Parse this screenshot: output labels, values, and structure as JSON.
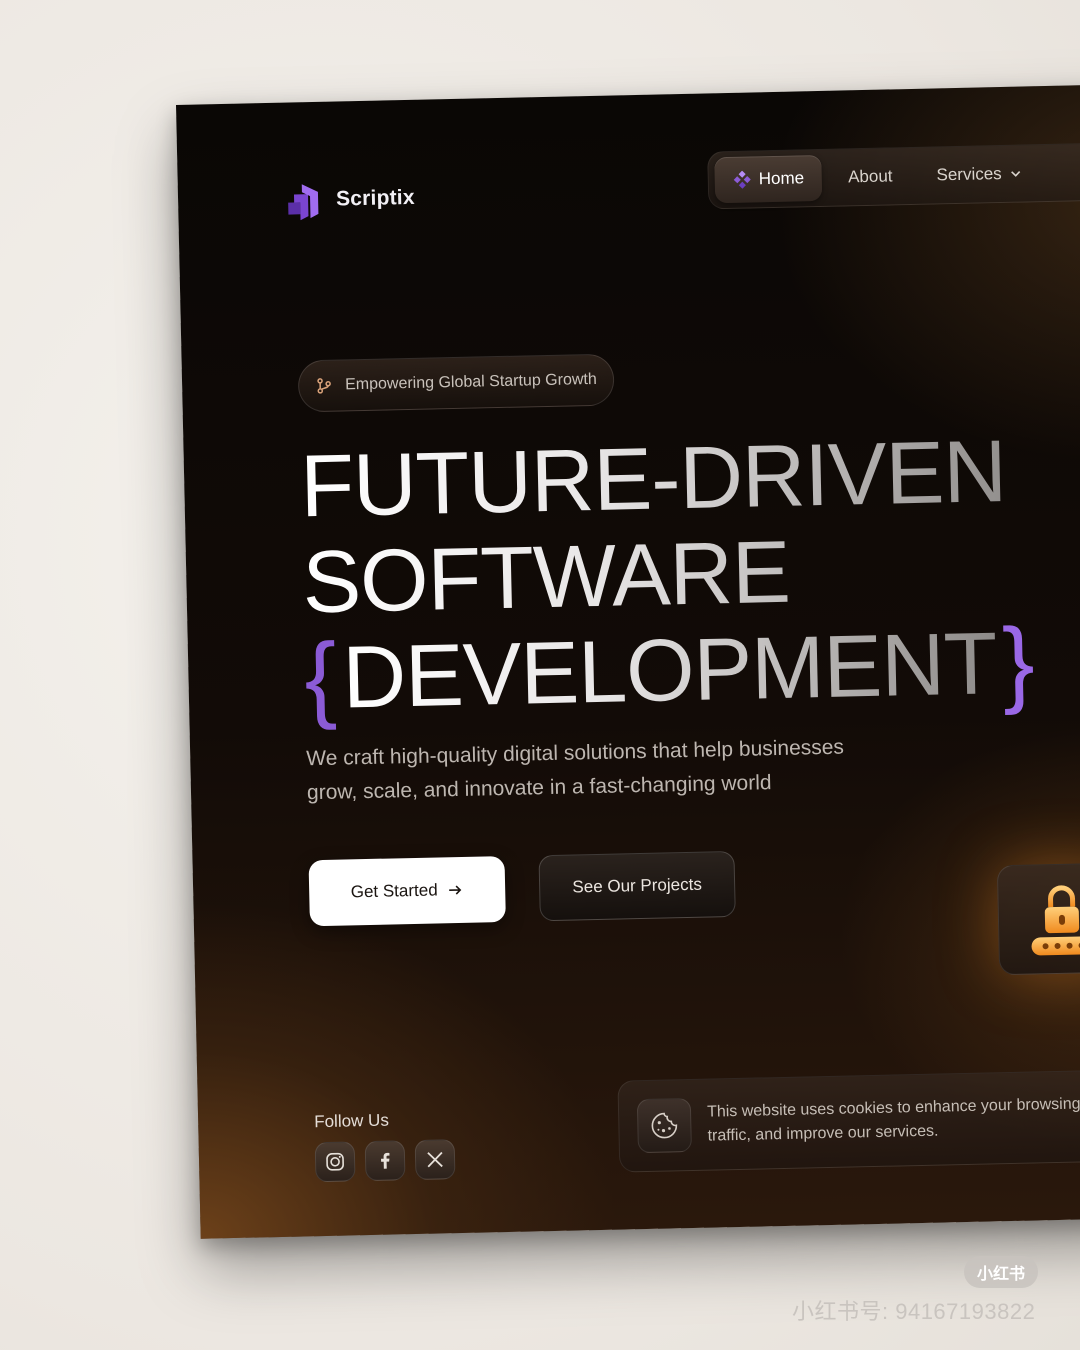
{
  "brand": {
    "name": "Scriptix",
    "accent": "#8b5bd6",
    "logo_icon": "scriptix-logo-icon"
  },
  "nav": {
    "items": [
      {
        "label": "Home",
        "active": true,
        "icon": "diamond-grid-icon"
      },
      {
        "label": "About",
        "active": false
      },
      {
        "label": "Services",
        "active": false,
        "icon": "chevron-down-icon"
      }
    ]
  },
  "hero": {
    "pill_label": "Empowering Global Startup Growth",
    "pill_icon": "git-branch-icon",
    "headline_line1": "FUTURE-DRIVEN",
    "headline_line2": "SOFTWARE",
    "brace_open": "{",
    "headline_line3": "DEVELOPMENT",
    "brace_close": "}",
    "subtitle_line1": "We craft high-quality digital solutions that help businesses",
    "subtitle_line2": "grow, scale, and innovate in a fast-changing world",
    "primary_cta": "Get Started",
    "secondary_cta": "See Our Projects"
  },
  "social": {
    "heading": "Follow Us",
    "icons": [
      "instagram-icon",
      "facebook-icon",
      "x-icon"
    ]
  },
  "cookie_banner": {
    "line1": "This website uses cookies to enhance your browsing",
    "line2": "traffic, and improve our services.",
    "icon": "cookie-icon"
  },
  "watermark": {
    "badge": "小红书",
    "id_text": "小红书号: 94167193822"
  }
}
